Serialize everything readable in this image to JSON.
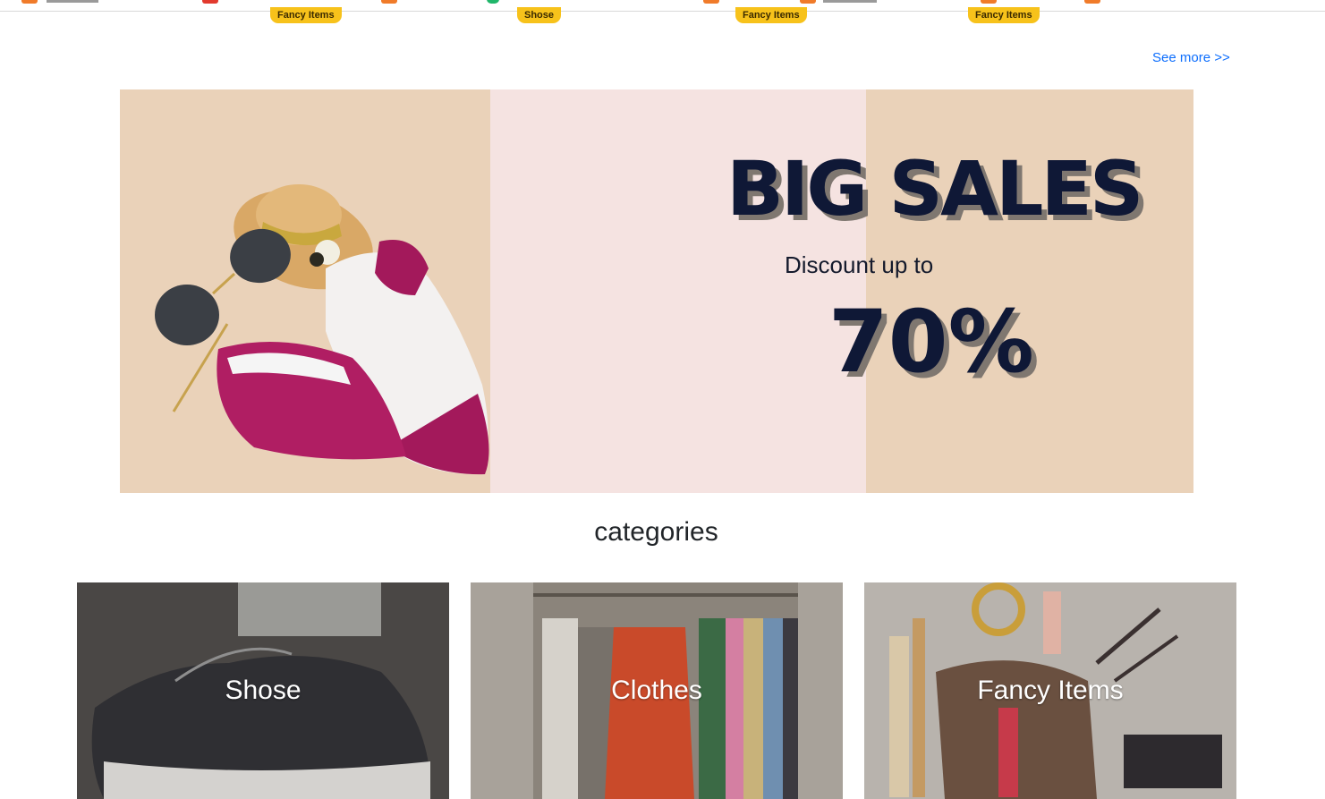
{
  "top_strip": {
    "tags": [
      "Fancy Items",
      "Shose",
      "Fancy Items",
      "Fancy Items"
    ]
  },
  "see_more_label": "See more >>",
  "banner": {
    "headline": "BIG SALES",
    "subline": "Discount up to",
    "discount_value": "70%"
  },
  "categories": {
    "title": "categories",
    "items": [
      {
        "label": "Shose"
      },
      {
        "label": "Clothes"
      },
      {
        "label": "Fancy Items"
      }
    ]
  },
  "colors": {
    "accent_link": "#0d6efd",
    "tag_yellow": "#f7c21b",
    "banner_beige": "#ead2b9",
    "headline_navy": "#0f1836"
  }
}
